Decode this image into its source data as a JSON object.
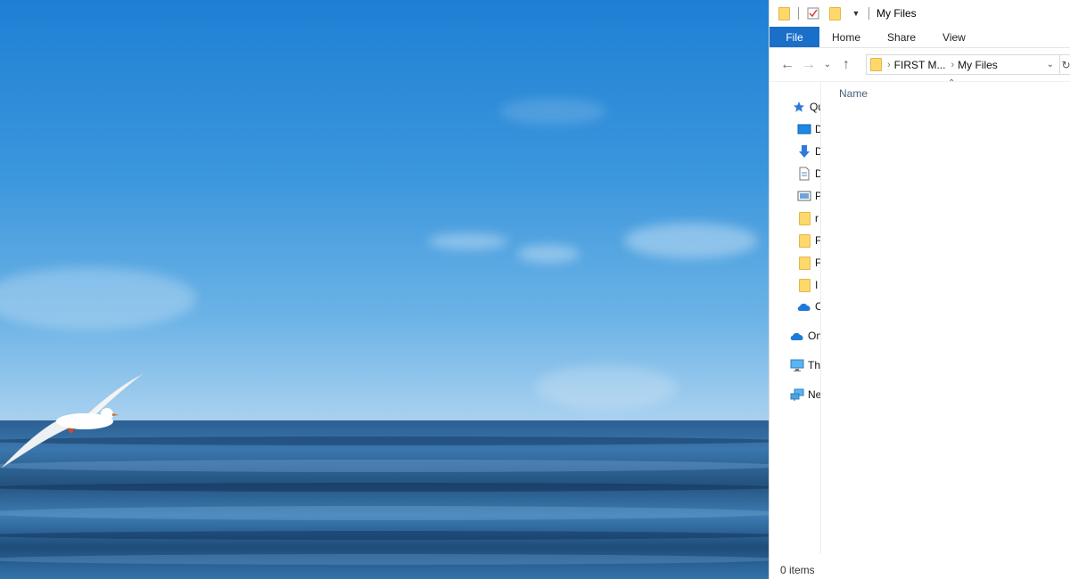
{
  "explorer": {
    "title": "My Files",
    "ribbon_tabs": [
      "File",
      "Home",
      "Share",
      "View"
    ],
    "breadcrumb": [
      "FIRST M...",
      "My Files"
    ],
    "content": {
      "column_header": "Name"
    },
    "nav": [
      {
        "name": "quick-access",
        "label": "Qu",
        "icon": "star-icon"
      },
      {
        "name": "desktop",
        "label": "D",
        "icon": "desktop-icon"
      },
      {
        "name": "downloads",
        "label": "D",
        "icon": "download-arrow-icon"
      },
      {
        "name": "documents",
        "label": "D",
        "icon": "document-icon"
      },
      {
        "name": "pictures",
        "label": "P",
        "icon": "pictures-icon"
      },
      {
        "name": "folder-1",
        "label": "r",
        "icon": "folder-icon"
      },
      {
        "name": "folder-2",
        "label": "F",
        "icon": "folder-icon"
      },
      {
        "name": "folder-3",
        "label": "F",
        "icon": "folder-icon"
      },
      {
        "name": "folder-4",
        "label": "I",
        "icon": "folder-icon"
      },
      {
        "name": "onedrive-sub",
        "label": "C",
        "icon": "cloud-icon"
      },
      {
        "name": "onedrive",
        "label": "On",
        "icon": "cloud-icon"
      },
      {
        "name": "this-pc",
        "label": "Th",
        "icon": "monitor-icon"
      },
      {
        "name": "network",
        "label": "Ne",
        "icon": "network-icon"
      }
    ],
    "status": {
      "item_count": "0 items"
    }
  },
  "colors": {
    "accent": "#1a6fc9",
    "folder": "#ffd86b"
  }
}
